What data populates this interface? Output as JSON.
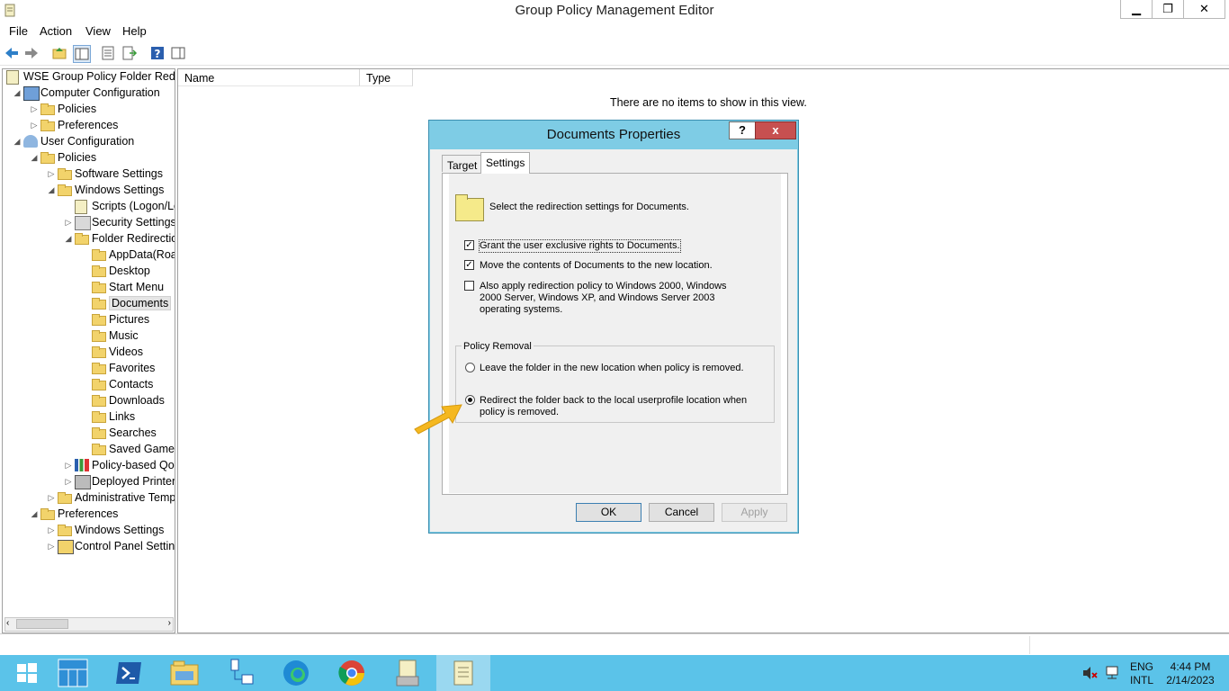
{
  "window": {
    "title": "Group Policy Management Editor"
  },
  "menu": [
    "File",
    "Action",
    "View",
    "Help"
  ],
  "tree": [
    {
      "label": "WSE Group Policy Folder Redire",
      "level": 0,
      "expander": "",
      "icon": "gpo-icon"
    },
    {
      "label": "Computer Configuration",
      "level": 1,
      "expander": "◢",
      "icon": "computer-icon"
    },
    {
      "label": "Policies",
      "level": 2,
      "expander": "▷",
      "icon": "folder-icon"
    },
    {
      "label": "Preferences",
      "level": 2,
      "expander": "▷",
      "icon": "folder-icon"
    },
    {
      "label": "User Configuration",
      "level": 1,
      "expander": "◢",
      "icon": "user-icon"
    },
    {
      "label": "Policies",
      "level": 2,
      "expander": "◢",
      "icon": "folder-icon"
    },
    {
      "label": "Software Settings",
      "level": 3,
      "expander": "▷",
      "icon": "folder-icon"
    },
    {
      "label": "Windows Settings",
      "level": 3,
      "expander": "◢",
      "icon": "folder-icon"
    },
    {
      "label": "Scripts (Logon/Lo",
      "level": 4,
      "expander": "",
      "icon": "script-icon"
    },
    {
      "label": "Security Settings",
      "level": 4,
      "expander": "▷",
      "icon": "security-icon"
    },
    {
      "label": "Folder Redirectio",
      "level": 4,
      "expander": "◢",
      "icon": "folder-icon"
    },
    {
      "label": "AppData(Roa",
      "level": 5,
      "expander": "",
      "icon": "folder-icon"
    },
    {
      "label": "Desktop",
      "level": 5,
      "expander": "",
      "icon": "folder-icon"
    },
    {
      "label": "Start Menu",
      "level": 5,
      "expander": "",
      "icon": "folder-icon"
    },
    {
      "label": "Documents",
      "level": 5,
      "expander": "",
      "icon": "folder-icon",
      "selected": true
    },
    {
      "label": "Pictures",
      "level": 5,
      "expander": "",
      "icon": "folder-icon"
    },
    {
      "label": "Music",
      "level": 5,
      "expander": "",
      "icon": "folder-icon"
    },
    {
      "label": "Videos",
      "level": 5,
      "expander": "",
      "icon": "folder-icon"
    },
    {
      "label": "Favorites",
      "level": 5,
      "expander": "",
      "icon": "folder-icon"
    },
    {
      "label": "Contacts",
      "level": 5,
      "expander": "",
      "icon": "folder-icon"
    },
    {
      "label": "Downloads",
      "level": 5,
      "expander": "",
      "icon": "folder-icon"
    },
    {
      "label": "Links",
      "level": 5,
      "expander": "",
      "icon": "folder-icon"
    },
    {
      "label": "Searches",
      "level": 5,
      "expander": "",
      "icon": "folder-icon"
    },
    {
      "label": "Saved Games",
      "level": 5,
      "expander": "",
      "icon": "folder-icon"
    },
    {
      "label": "Policy-based QoS",
      "level": 4,
      "expander": "▷",
      "icon": "chart-icon"
    },
    {
      "label": "Deployed Printers",
      "level": 4,
      "expander": "▷",
      "icon": "printer-icon"
    },
    {
      "label": "Administrative Temp",
      "level": 3,
      "expander": "▷",
      "icon": "folder-icon"
    },
    {
      "label": "Preferences",
      "level": 2,
      "expander": "◢",
      "icon": "folder-icon"
    },
    {
      "label": "Windows Settings",
      "level": 3,
      "expander": "▷",
      "icon": "folder-icon"
    },
    {
      "label": "Control Panel Setting",
      "level": 3,
      "expander": "▷",
      "icon": "control-panel-icon"
    }
  ],
  "list": {
    "columns": [
      "Name",
      "Type"
    ],
    "empty_message": "There are no items to show in this view."
  },
  "dialog": {
    "title": "Documents Properties",
    "help": "?",
    "close": "x",
    "tabs": [
      "Target",
      "Settings"
    ],
    "active_tab": "Settings",
    "header_text": "Select the redirection settings for Documents.",
    "checkboxes": [
      {
        "label": "Grant the user exclusive rights to Documents.",
        "checked": true
      },
      {
        "label": "Move the contents of Documents to the new location.",
        "checked": true
      },
      {
        "label": "Also apply redirection policy to Windows 2000, Windows 2000 Server, Windows XP, and Windows Server 2003 operating systems.",
        "checked": false
      }
    ],
    "policy_removal": {
      "title": "Policy Removal",
      "options": [
        {
          "label": "Leave the folder in the new location when policy is removed.",
          "selected": false
        },
        {
          "label": "Redirect the folder back to the local userprofile location when policy is removed.",
          "selected": true
        }
      ]
    },
    "buttons": {
      "ok": "OK",
      "cancel": "Cancel",
      "apply": "Apply"
    }
  },
  "taskbar": {
    "apps": [
      "start-icon",
      "server-manager-icon",
      "powershell-icon",
      "file-explorer-icon",
      "network-icon",
      "edge-icon",
      "chrome-icon",
      "gpmc-icon",
      "gp-editor-icon"
    ],
    "language": "ENG",
    "layout": "INTL",
    "time": "4:44 PM",
    "date": "2/14/2023"
  },
  "colors": {
    "taskbar": "#5bc3e9",
    "dialog_frame": "#7ecce5",
    "close_red": "#c75050",
    "arrow": "#f5b820"
  }
}
